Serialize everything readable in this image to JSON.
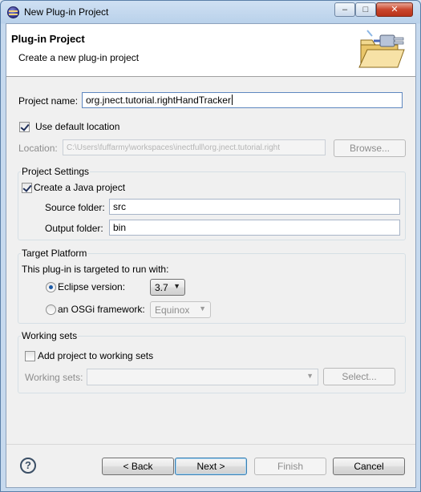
{
  "window": {
    "title": "New Plug-in Project",
    "minimize_glyph": "–",
    "maximize_glyph": "□",
    "close_glyph": "✕"
  },
  "header": {
    "title": "Plug-in Project",
    "subtitle": "Create a new plug-in project"
  },
  "form": {
    "project_name_label": "Project name:",
    "project_name_value": "org.jnect.tutorial.rightHandTracker",
    "use_default_location_label": "Use default location",
    "use_default_location_checked": true,
    "location_label": "Location:",
    "location_value": "C:\\Users\\fuffarmy\\workspaces\\inectfull\\org.jnect.tutorial.right",
    "browse_label": "Browse..."
  },
  "project_settings": {
    "group_title": "Project Settings",
    "create_java_label": "Create a Java project",
    "create_java_checked": true,
    "source_folder_label": "Source folder:",
    "source_folder_value": "src",
    "output_folder_label": "Output folder:",
    "output_folder_value": "bin"
  },
  "target_platform": {
    "group_title": "Target Platform",
    "intro": "This plug-in is targeted to run with:",
    "eclipse_label": "Eclipse version:",
    "eclipse_value": "3.7",
    "osgi_label": "an OSGi framework:",
    "osgi_value": "Equinox",
    "selected": "eclipse"
  },
  "working_sets": {
    "group_title": "Working sets",
    "add_label": "Add project to working sets",
    "add_checked": false,
    "sets_label": "Working sets:",
    "sets_value": "",
    "select_label": "Select..."
  },
  "footer": {
    "help_glyph": "?",
    "back_label": "< Back",
    "next_label": "Next >",
    "finish_label": "Finish",
    "cancel_label": "Cancel"
  },
  "icons": [
    "eclipse-app-icon",
    "plugin-folder-icon",
    "help-icon",
    "dropdown-arrow-icon"
  ]
}
